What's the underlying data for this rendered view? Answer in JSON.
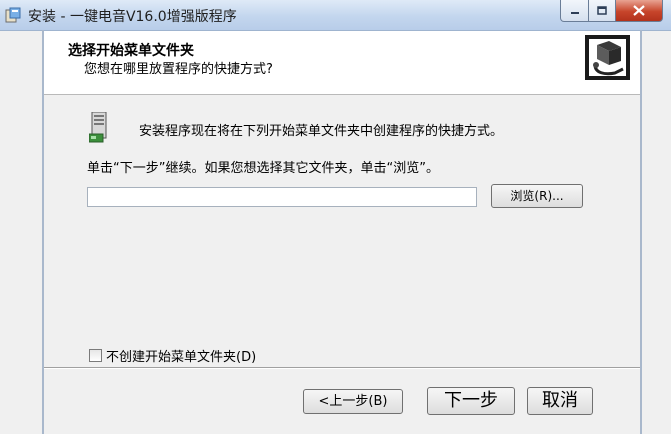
{
  "window": {
    "title": "安装 - 一键电音V16.0增强版程序"
  },
  "header": {
    "title": "选择开始菜单文件夹",
    "subtitle": "您想在哪里放置程序的快捷方式?"
  },
  "content": {
    "description": "安装程序现在将在下列开始菜单文件夹中创建程序的快捷方式。",
    "instruction": "单击“下一步”继续。如果您想选择其它文件夹，单击“浏览”。",
    "folder_input_value": "",
    "browse_label": "浏览(R)...",
    "no_folder_checkbox_label": "不创建开始菜单文件夹(D)",
    "no_folder_checked": false
  },
  "buttons": {
    "back_label": "<上一步(B)",
    "next_label": "下一步",
    "cancel_label": "取消"
  },
  "icons": {
    "app": "installer-app-icon",
    "header": "computer-install-icon",
    "folder": "start-menu-folder-icon",
    "minimize": "minimize-icon",
    "maximize": "maximize-icon",
    "close": "close-icon"
  }
}
